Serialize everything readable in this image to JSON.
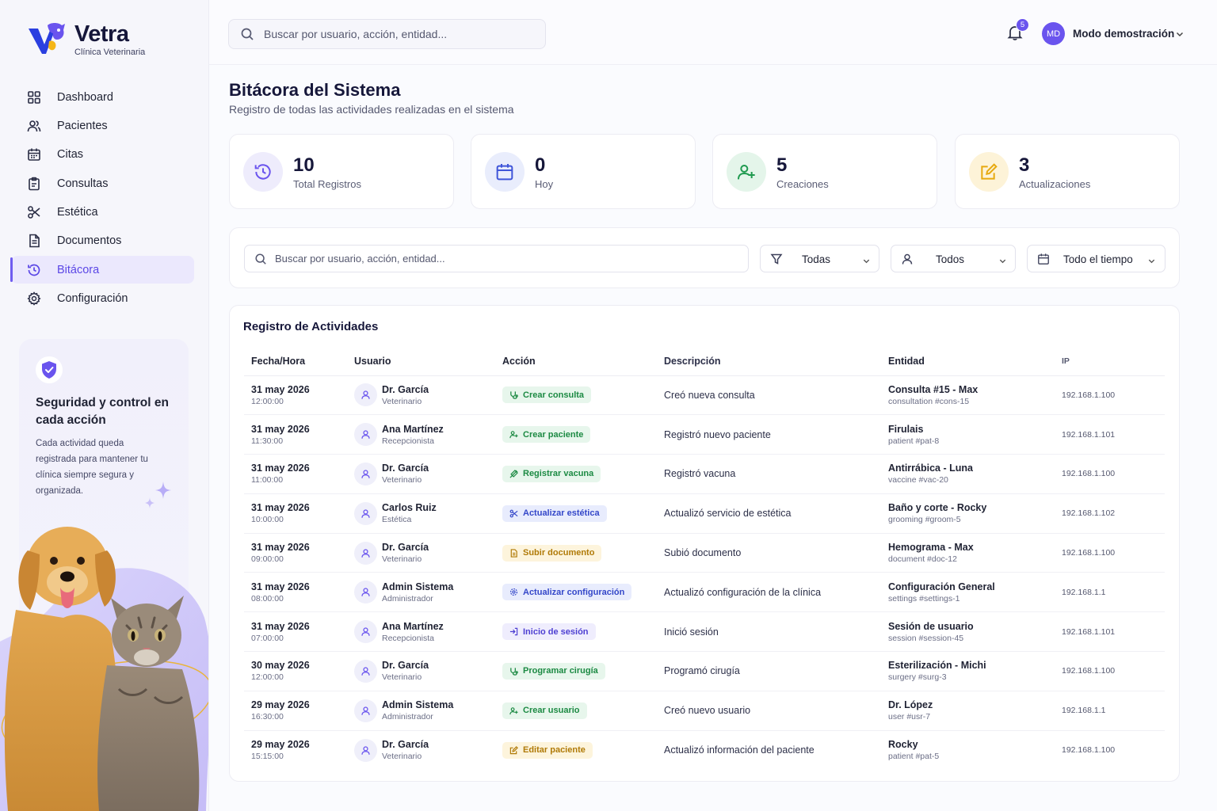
{
  "brand": {
    "name": "Vetra",
    "subtitle": "Clínica Veterinaria"
  },
  "sidebar": {
    "items": [
      {
        "label": "Dashboard",
        "icon": "grid-icon"
      },
      {
        "label": "Pacientes",
        "icon": "users-icon"
      },
      {
        "label": "Citas",
        "icon": "calendar-icon"
      },
      {
        "label": "Consultas",
        "icon": "clipboard-icon"
      },
      {
        "label": "Estética",
        "icon": "scissors-icon"
      },
      {
        "label": "Documentos",
        "icon": "document-icon"
      },
      {
        "label": "Bitácora",
        "icon": "history-icon",
        "active": true
      },
      {
        "label": "Configuración",
        "icon": "gear-icon"
      }
    ],
    "promo": {
      "title": "Seguridad y control en cada acción",
      "text": "Cada actividad queda registrada para mantener tu clínica siempre segura y organizada."
    }
  },
  "topbar": {
    "search_placeholder": "Buscar por usuario, acción, entidad...",
    "notifications_count": "5",
    "user_initials": "MD",
    "user_name": "Modo demostración"
  },
  "page": {
    "title": "Bitácora del Sistema",
    "subtitle": "Registro de todas las actividades realizadas en el sistema"
  },
  "stats": [
    {
      "value": "10",
      "label": "Total Registros",
      "icon": "history-icon",
      "color": "#6a54ee",
      "bg": "#eeecfc"
    },
    {
      "value": "0",
      "label": "Hoy",
      "icon": "calendar-icon",
      "color": "#3f55d9",
      "bg": "#e9edfc"
    },
    {
      "value": "5",
      "label": "Creaciones",
      "icon": "user-plus-icon",
      "color": "#1f9a4f",
      "bg": "#e4f5ea"
    },
    {
      "value": "3",
      "label": "Actualizaciones",
      "icon": "edit-icon",
      "color": "#e7a90f",
      "bg": "#fdf3d8"
    }
  ],
  "filters": {
    "search_placeholder": "Buscar por usuario, acción, entidad...",
    "action_filter": "Todas",
    "user_filter": "Todos",
    "time_filter": "Todo el tiempo"
  },
  "table": {
    "title": "Registro de Actividades",
    "columns": [
      "Fecha/Hora",
      "Usuario",
      "Acción",
      "Descripción",
      "Entidad",
      "IP"
    ],
    "rows": [
      {
        "date": "31 may 2026",
        "time": "12:00:00",
        "user": "Dr. García",
        "role": "Veterinario",
        "action": "Crear consulta",
        "action_icon": "stethoscope-icon",
        "action_color": "green",
        "description": "Creó nueva consulta",
        "entity": "Consulta #15 - Max",
        "entity_ref": "consultation #cons-15",
        "ip": "192.168.1.100"
      },
      {
        "date": "31 may 2026",
        "time": "11:30:00",
        "user": "Ana Martínez",
        "role": "Recepcionista",
        "action": "Crear paciente",
        "action_icon": "user-plus-icon",
        "action_color": "green",
        "description": "Registró nuevo paciente",
        "entity": "Firulais",
        "entity_ref": "patient #pat-8",
        "ip": "192.168.1.101"
      },
      {
        "date": "31 may 2026",
        "time": "11:00:00",
        "user": "Dr. García",
        "role": "Veterinario",
        "action": "Registrar vacuna",
        "action_icon": "syringe-icon",
        "action_color": "green",
        "description": "Registró vacuna",
        "entity": "Antirrábica - Luna",
        "entity_ref": "vaccine #vac-20",
        "ip": "192.168.1.100"
      },
      {
        "date": "31 may 2026",
        "time": "10:00:00",
        "user": "Carlos Ruiz",
        "role": "Estética",
        "action": "Actualizar estética",
        "action_icon": "scissors-icon",
        "action_color": "blue",
        "description": "Actualizó servicio de estética",
        "entity": "Baño y corte - Rocky",
        "entity_ref": "grooming #groom-5",
        "ip": "192.168.1.102"
      },
      {
        "date": "31 may 2026",
        "time": "09:00:00",
        "user": "Dr. García",
        "role": "Veterinario",
        "action": "Subir documento",
        "action_icon": "document-icon",
        "action_color": "yellow",
        "description": "Subió documento",
        "entity": "Hemograma - Max",
        "entity_ref": "document #doc-12",
        "ip": "192.168.1.100"
      },
      {
        "date": "31 may 2026",
        "time": "08:00:00",
        "user": "Admin Sistema",
        "role": "Administrador",
        "action": "Actualizar configuración",
        "action_icon": "gear-icon",
        "action_color": "blue",
        "description": "Actualizó configuración de la clínica",
        "entity": "Configuración General",
        "entity_ref": "settings #settings-1",
        "ip": "192.168.1.1"
      },
      {
        "date": "31 may 2026",
        "time": "07:00:00",
        "user": "Ana Martínez",
        "role": "Recepcionista",
        "action": "Inicio de sesión",
        "action_icon": "login-icon",
        "action_color": "violet",
        "description": "Inició sesión",
        "entity": "Sesión de usuario",
        "entity_ref": "session #session-45",
        "ip": "192.168.1.101"
      },
      {
        "date": "30 may 2026",
        "time": "12:00:00",
        "user": "Dr. García",
        "role": "Veterinario",
        "action": "Programar cirugía",
        "action_icon": "stethoscope-icon",
        "action_color": "green",
        "description": "Programó cirugía",
        "entity": "Esterilización - Michi",
        "entity_ref": "surgery #surg-3",
        "ip": "192.168.1.100"
      },
      {
        "date": "29 may 2026",
        "time": "16:30:00",
        "user": "Admin Sistema",
        "role": "Administrador",
        "action": "Crear usuario",
        "action_icon": "user-plus-icon",
        "action_color": "green",
        "description": "Creó nuevo usuario",
        "entity": "Dr. López",
        "entity_ref": "user #usr-7",
        "ip": "192.168.1.1"
      },
      {
        "date": "29 may 2026",
        "time": "15:15:00",
        "user": "Dr. García",
        "role": "Veterinario",
        "action": "Editar paciente",
        "action_icon": "edit-icon",
        "action_color": "yellow",
        "description": "Actualizó información del paciente",
        "entity": "Rocky",
        "entity_ref": "patient #pat-5",
        "ip": "192.168.1.100"
      }
    ]
  }
}
